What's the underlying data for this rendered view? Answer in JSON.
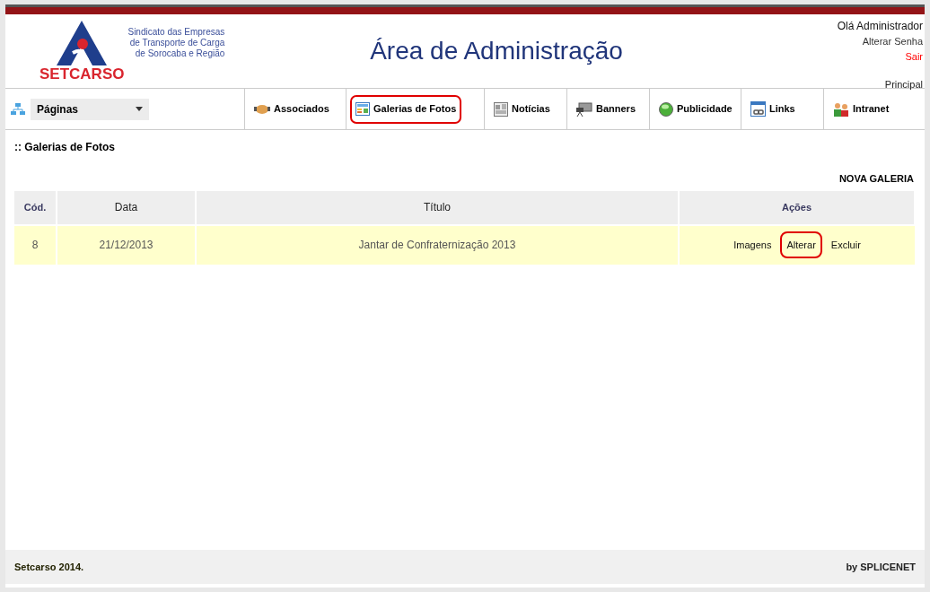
{
  "header": {
    "logo_text": "SETCARSO",
    "tagline": [
      "Sindicato das Empresas",
      "de Transporte de Carga",
      "de Sorocaba e Região"
    ],
    "title": "Área de Administração",
    "user_links": [
      {
        "kind": "greeting",
        "label": "Olá Administrador"
      },
      {
        "kind": "link",
        "label": "Alterar Senha"
      },
      {
        "kind": "logout",
        "label": "Sair"
      }
    ],
    "breadcrumb": "Principal"
  },
  "nav": {
    "dropdown": "Páginas",
    "items": [
      {
        "label": "Associados",
        "highlighted": false
      },
      {
        "label": "Galerias de Fotos",
        "highlighted": true
      },
      {
        "label": "Notícias",
        "highlighted": false
      },
      {
        "label": "Banners",
        "highlighted": false
      },
      {
        "label": "Publicidade",
        "highlighted": false
      },
      {
        "label": "Links",
        "highlighted": false
      },
      {
        "label": "Intranet",
        "highlighted": false
      }
    ]
  },
  "section_title": ":: Galerias de Fotos",
  "new_button": "NOVA GALERIA",
  "table": {
    "columns": [
      "Cód.",
      "Data",
      "Título",
      "Ações"
    ],
    "rows": [
      {
        "cells": [
          "8",
          "21/12/2013",
          "Jantar de Confraternização 2013"
        ],
        "actions": [
          {
            "label": "Imagens",
            "highlighted": false
          },
          {
            "label": "Alterar",
            "highlighted": true
          },
          {
            "label": "Excluir",
            "highlighted": false
          }
        ]
      }
    ]
  },
  "footer": {
    "left": "Setcarso 2014.",
    "right": "by SPLICENET"
  }
}
